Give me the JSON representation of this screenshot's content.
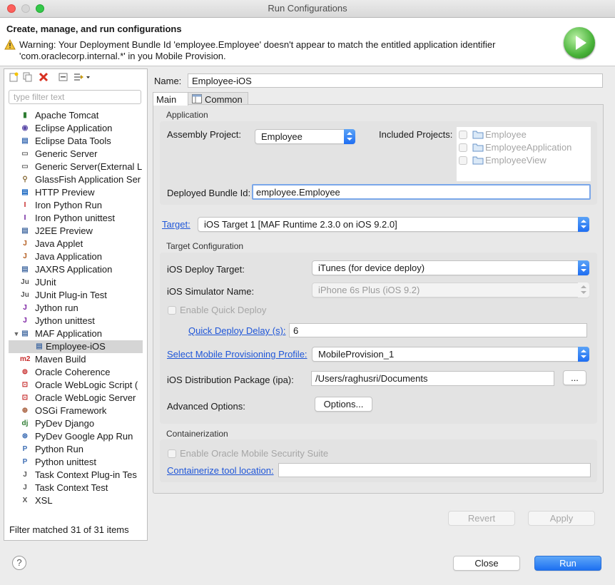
{
  "window": {
    "title": "Run Configurations"
  },
  "header": {
    "title": "Create, manage, and run configurations",
    "warning_line1": "Warning: Your Deployment Bundle Id 'employee.Employee' doesn't appear to match the entitled application identifier",
    "warning_line2": "'com.oraclecorp.internal.*' in you Mobile Provision."
  },
  "sidebar": {
    "filter_placeholder": "type filter text",
    "filter_status": "Filter matched 31 of 31 items",
    "items": [
      {
        "label": "Apache Tomcat",
        "icon": "tomcat-icon"
      },
      {
        "label": "Eclipse Application",
        "icon": "eclipse-icon"
      },
      {
        "label": "Eclipse Data Tools",
        "icon": "data-tools-icon"
      },
      {
        "label": "Generic Server",
        "icon": "server-icon"
      },
      {
        "label": "Generic Server(External L",
        "icon": "server-icon"
      },
      {
        "label": "GlassFish Application Ser",
        "icon": "glassfish-icon"
      },
      {
        "label": "HTTP Preview",
        "icon": "http-icon"
      },
      {
        "label": "Iron Python Run",
        "icon": "iron-python-icon"
      },
      {
        "label": "Iron Python unittest",
        "icon": "iron-python-unittest-icon"
      },
      {
        "label": "J2EE Preview",
        "icon": "j2ee-icon"
      },
      {
        "label": "Java Applet",
        "icon": "java-applet-icon"
      },
      {
        "label": "Java Application",
        "icon": "java-app-icon"
      },
      {
        "label": "JAXRS Application",
        "icon": "jaxrs-icon"
      },
      {
        "label": "JUnit",
        "icon": "junit-icon"
      },
      {
        "label": "JUnit Plug-in Test",
        "icon": "junit-plugin-icon"
      },
      {
        "label": "Jython run",
        "icon": "jython-icon"
      },
      {
        "label": "Jython unittest",
        "icon": "jython-unittest-icon"
      },
      {
        "label": "MAF Application",
        "icon": "maf-icon"
      },
      {
        "label": "Employee-iOS",
        "icon": "maf-config-icon"
      },
      {
        "label": "Maven Build",
        "icon": "maven-icon"
      },
      {
        "label": "Oracle Coherence",
        "icon": "coherence-icon"
      },
      {
        "label": "Oracle WebLogic Script (",
        "icon": "wlst-icon"
      },
      {
        "label": "Oracle WebLogic Server",
        "icon": "weblogic-icon"
      },
      {
        "label": "OSGi Framework",
        "icon": "osgi-icon"
      },
      {
        "label": "PyDev Django",
        "icon": "django-icon"
      },
      {
        "label": "PyDev Google App Run",
        "icon": "google-app-icon"
      },
      {
        "label": "Python Run",
        "icon": "python-icon"
      },
      {
        "label": "Python unittest",
        "icon": "python-unittest-icon"
      },
      {
        "label": "Task Context Plug-in Tes",
        "icon": "task-context-plugin-icon"
      },
      {
        "label": "Task Context Test",
        "icon": "task-context-icon"
      },
      {
        "label": "XSL",
        "icon": "xsl-icon"
      }
    ]
  },
  "form": {
    "name_label": "Name:",
    "name_value": "Employee-iOS",
    "tabs": [
      {
        "label": "Main"
      },
      {
        "label": "Common"
      }
    ],
    "application": {
      "title": "Application",
      "assembly_label": "Assembly Project:",
      "assembly_value": "Employee",
      "included_label": "Included Projects:",
      "included": [
        "Employee",
        "EmployeeApplication",
        "EmployeeView"
      ],
      "bundle_label": "Deployed Bundle Id:",
      "bundle_value": "employee.Employee"
    },
    "target_label": "Target:",
    "target_value": "iOS Target 1 [MAF Runtime 2.3.0 on iOS 9.2.0]",
    "target_config": {
      "title": "Target Configuration",
      "deploy_target_label": "iOS Deploy Target:",
      "deploy_target_value": "iTunes (for device deploy)",
      "simulator_label": "iOS Simulator Name:",
      "simulator_value": "iPhone 6s Plus (iOS 9.2)",
      "quick_deploy_label": "Enable Quick Deploy",
      "quick_delay_label": "Quick Deploy Delay (s):",
      "quick_delay_value": "6",
      "profile_label": "Select Mobile Provisioning Profile:",
      "profile_value": "MobileProvision_1",
      "ipa_label": "iOS Distribution Package (ipa):",
      "ipa_value": "/Users/raghusri/Documents",
      "browse_label": "...",
      "advanced_label": "Advanced Options:",
      "options_button": "Options..."
    },
    "containerization": {
      "title": "Containerization",
      "enable_label": "Enable Oracle Mobile Security Suite",
      "tool_label": "Containerize tool location:",
      "tool_value": ""
    },
    "revert_button": "Revert",
    "apply_button": "Apply"
  },
  "footer": {
    "help": "?",
    "close_button": "Close",
    "run_button": "Run"
  }
}
